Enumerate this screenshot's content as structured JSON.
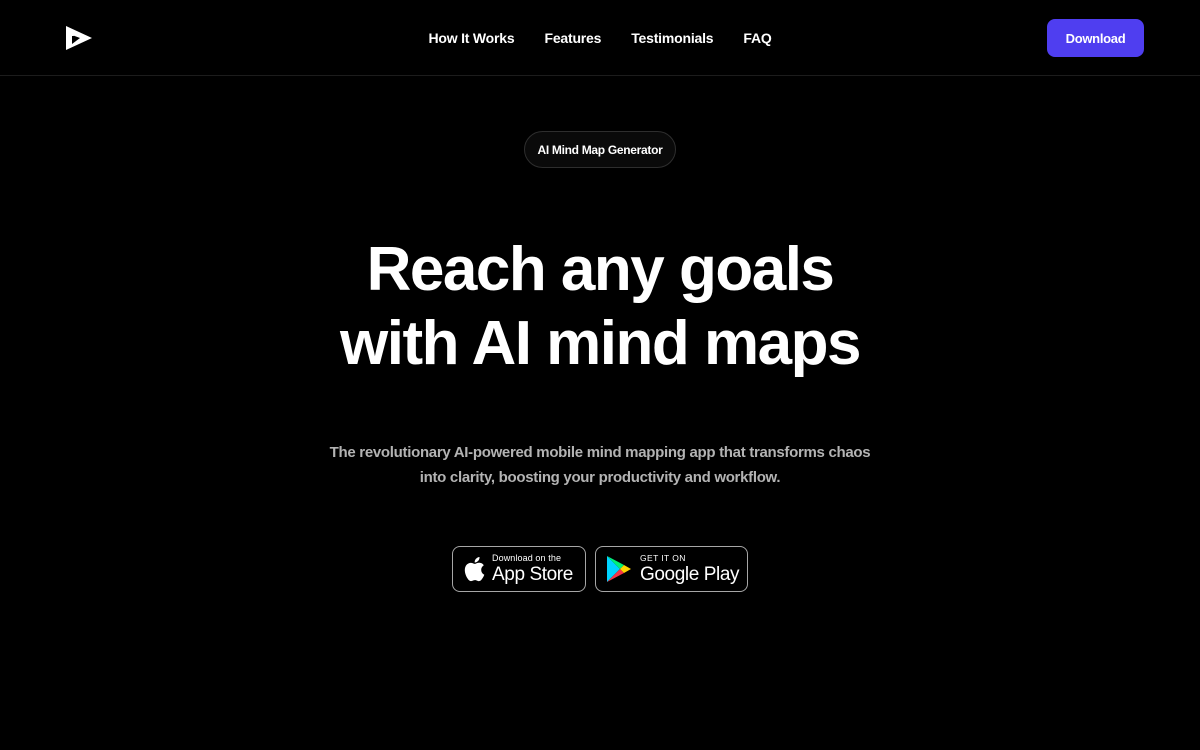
{
  "header": {
    "logo_icon": "play-triangle-logo-icon",
    "nav": {
      "how_it_works": "How It Works",
      "features": "Features",
      "testimonials": "Testimonials",
      "faq": "FAQ"
    },
    "download_label": "Download"
  },
  "hero": {
    "badge": "AI Mind Map Generator",
    "headline_line1": "Reach any goals",
    "headline_line2": "with AI mind maps",
    "subtitle_line1": "The revolutionary AI-powered mobile mind mapping app that transforms chaos",
    "subtitle_line2": "into clarity, boosting your productivity and workflow."
  },
  "stores": {
    "apple": {
      "icon": "apple-logo-icon",
      "small": "Download on the",
      "big": "App Store"
    },
    "google": {
      "icon": "google-play-logo-icon",
      "small": "GET IT ON",
      "big": "Google Play"
    }
  },
  "colors": {
    "background": "#000000",
    "accent": "#4f3ef0",
    "subtitle": "#b3b3b3",
    "border": "#2e2e2e"
  }
}
